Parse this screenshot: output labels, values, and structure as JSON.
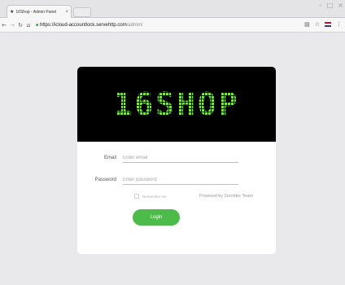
{
  "browser": {
    "tab_title": "16Shop - Admin Panel",
    "tab_icon": "★",
    "tab_close": "×",
    "url_scheme": "https://",
    "url_host": "icloud-accountlock.servehttp.com",
    "url_path": "/admin/",
    "window_controls": [
      "–",
      "□",
      "×"
    ]
  },
  "login": {
    "logo": "16SHOP",
    "email_label": "Email",
    "email_placeholder": "Enter email",
    "password_label": "Password",
    "password_placeholder": "Enter password",
    "remember_label": "Remember me",
    "powered_by": "Powered by Zerolder Team",
    "login_button": "Login"
  },
  "colors": {
    "accent": "#4cbb4a",
    "logo_green": "#7fe04a",
    "background": "#e9e9eb"
  }
}
